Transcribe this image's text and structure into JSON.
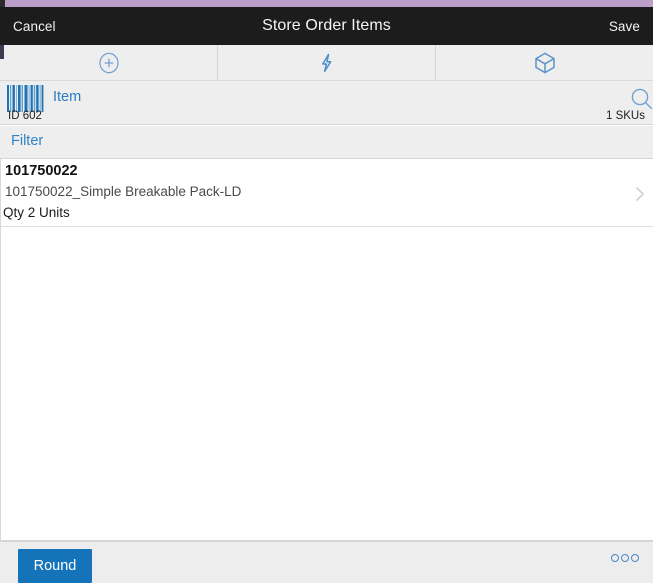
{
  "window": {
    "accent_color": "#bb9ec9",
    "titlebar_bg": "#1c1c1c"
  },
  "titlebar": {
    "cancel_label": "Cancel",
    "title": "Store Order Items",
    "save_label": "Save"
  },
  "tabs": [
    {
      "icon": "plus-circle-icon",
      "label": ""
    },
    {
      "icon": "lightning-bolt-icon",
      "label": ""
    },
    {
      "icon": "cube-box-icon",
      "label": ""
    }
  ],
  "item_header": {
    "icon": "barcode-icon",
    "label": "Item",
    "search_icon": "search-icon",
    "id_text": "ID 602",
    "sku_count_text": "1 SKUs"
  },
  "filter": {
    "label": "Filter"
  },
  "list": {
    "rows": [
      {
        "title": "101750022",
        "subtitle": "101750022_Simple Breakable Pack-LD",
        "qty": "Qty 2 Units",
        "chevron": "chevron-right-icon"
      }
    ]
  },
  "bottombar": {
    "round_label": "Round",
    "overflow_label": "ooo",
    "accent_color": "#1574b9"
  }
}
